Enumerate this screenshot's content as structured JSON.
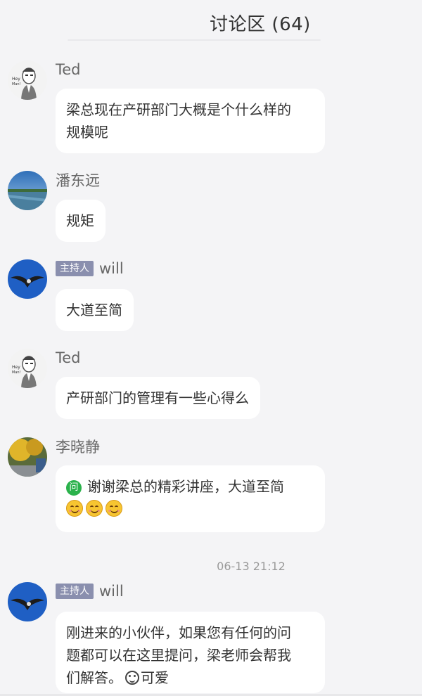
{
  "header": {
    "title": "讨论区 (64)"
  },
  "messages": [
    {
      "name": "Ted",
      "host": false,
      "avatar": "cartoon-man-avatar",
      "lines": [
        "梁总现在产研部门大概是个什么样的",
        "规模呢"
      ]
    },
    {
      "name": "潘东远",
      "host": false,
      "avatar": "lake-landscape-avatar",
      "lines": [
        "规矩"
      ]
    },
    {
      "name": "will",
      "host": true,
      "badge": "主持人",
      "avatar": "eagle-avatar",
      "lines": [
        "大道至简"
      ]
    },
    {
      "name": "Ted",
      "host": false,
      "avatar": "cartoon-man-avatar",
      "lines": [
        "产研部门的管理有一些心得么"
      ]
    },
    {
      "name": "李晓静",
      "host": false,
      "avatar": "autumn-tree-avatar",
      "question_icon": "问",
      "lines": [
        "谢谢梁总的精彩讲座，大道至简"
      ],
      "emojis": [
        "smile-emoji",
        "smile-emoji",
        "smile-emoji"
      ]
    },
    {
      "name": "will",
      "host": true,
      "badge": "主持人",
      "avatar": "eagle-avatar",
      "lines": [
        "刚进来的小伙伴，如果您有任何的问",
        "题都可以在这里提问，梁老师会帮我",
        "们解答。",
        "可爱"
      ],
      "inline_emoji": "cute-emoji"
    }
  ],
  "timestamp": "06-13 21:12",
  "colors": {
    "background": "#f4f4f6",
    "bubble": "#ffffff",
    "host_badge": "#8a8fae",
    "question_icon": "#2bb24c"
  }
}
